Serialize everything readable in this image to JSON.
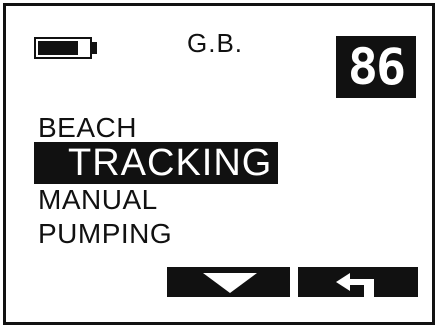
{
  "status": {
    "battery_icon": "battery-icon",
    "mode_label": "G.B.",
    "value": "86"
  },
  "menu": {
    "items": [
      "BEACH",
      "TRACKING",
      "MANUAL",
      "PUMPING"
    ],
    "selected_index": 1
  },
  "softkeys": [
    {
      "icon": "down-arrow-icon"
    },
    {
      "icon": "back-arrow-icon"
    }
  ],
  "colors": {
    "foreground": "#111111",
    "background": "#ffffff"
  }
}
